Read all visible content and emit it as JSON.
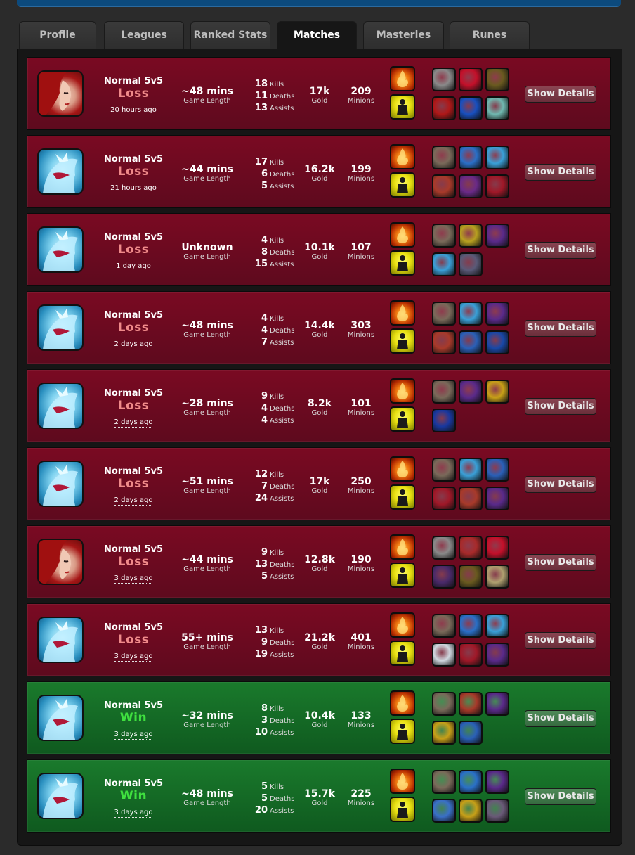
{
  "tabs": [
    "Profile",
    "Leagues",
    "Ranked Stats",
    "Matches",
    "Masteries",
    "Runes"
  ],
  "active_tab": "Matches",
  "labels": {
    "game_length": "Game Length",
    "kills": "Kills",
    "deaths": "Deaths",
    "assists": "Assists",
    "gold": "Gold",
    "minions": "Minions",
    "details_button": "Show Details"
  },
  "spells": [
    "ignite-icon",
    "ghost-icon"
  ],
  "matches": [
    {
      "champion": "red-haired-champion",
      "queue": "Normal 5v5",
      "result": "Loss",
      "ago": "20 hours ago",
      "length": "~48 mins",
      "kills": "18",
      "deaths": "11",
      "assists": "13",
      "gold": "17k",
      "minions": "209",
      "items": [
        "#8a8a8a",
        "#c4102a",
        "#6a5a20",
        "#b01818",
        "#1850c0",
        "#70b8b0"
      ]
    },
    {
      "champion": "ice-champion",
      "queue": "Normal 5v5",
      "result": "Loss",
      "ago": "21 hours ago",
      "length": "~44 mins",
      "kills": "17",
      "deaths": "6",
      "assists": "5",
      "gold": "16.2k",
      "minions": "199",
      "items": [
        "#7a6a5a",
        "#2a70c8",
        "#3aa0d8",
        "#a83a2a",
        "#6a2a88",
        "#a01828"
      ]
    },
    {
      "champion": "ice-champion",
      "queue": "Normal 5v5",
      "result": "Loss",
      "ago": "1 day ago",
      "length": "Unknown",
      "kills": "4",
      "deaths": "8",
      "assists": "15",
      "gold": "10.1k",
      "minions": "107",
      "items": [
        "#7a6a5a",
        "#b8a020",
        "#5a2a8a",
        "#3aa0d8",
        "#5a5a78"
      ]
    },
    {
      "champion": "ice-champion",
      "queue": "Normal 5v5",
      "result": "Loss",
      "ago": "2 days ago",
      "length": "~48 mins",
      "kills": "4",
      "deaths": "4",
      "assists": "7",
      "gold": "14.4k",
      "minions": "303",
      "items": [
        "#7a6a5a",
        "#3aa0d8",
        "#5a2a8a",
        "#a83a2a",
        "#2a60b8",
        "#1848a8"
      ]
    },
    {
      "champion": "ice-champion",
      "queue": "Normal 5v5",
      "result": "Loss",
      "ago": "2 days ago",
      "length": "~28 mins",
      "kills": "9",
      "deaths": "4",
      "assists": "4",
      "gold": "8.2k",
      "minions": "101",
      "items": [
        "#7a6a5a",
        "#5a2a8a",
        "#c8a018",
        "#1838a0"
      ]
    },
    {
      "champion": "ice-champion",
      "queue": "Normal 5v5",
      "result": "Loss",
      "ago": "2 days ago",
      "length": "~51 mins",
      "kills": "12",
      "deaths": "7",
      "assists": "24",
      "gold": "17k",
      "minions": "250",
      "items": [
        "#7a6a5a",
        "#3aa0d8",
        "#2a60b8",
        "#a01828",
        "#a83a2a",
        "#5a2a8a"
      ]
    },
    {
      "champion": "red-haired-champion",
      "queue": "Normal 5v5",
      "result": "Loss",
      "ago": "3 days ago",
      "length": "~44 mins",
      "kills": "9",
      "deaths": "13",
      "assists": "5",
      "gold": "12.8k",
      "minions": "190",
      "items": [
        "#8a8a8a",
        "#a82a2a",
        "#c4102a",
        "#4a2a6a",
        "#6a5a20",
        "#b0a070"
      ]
    },
    {
      "champion": "ice-champion",
      "queue": "Normal 5v5",
      "result": "Loss",
      "ago": "3 days ago",
      "length": "55+ mins",
      "kills": "13",
      "deaths": "9",
      "assists": "19",
      "gold": "21.2k",
      "minions": "401",
      "items": [
        "#7a6a5a",
        "#2a70c8",
        "#3aa0d8",
        "#d0d8e0",
        "#a01828",
        "#5a2a8a"
      ]
    },
    {
      "champion": "ice-champion",
      "queue": "Normal 5v5",
      "result": "Win",
      "ago": "3 days ago",
      "length": "~32 mins",
      "kills": "8",
      "deaths": "3",
      "assists": "10",
      "gold": "10.4k",
      "minions": "133",
      "items": [
        "#7a6a5a",
        "#a83a2a",
        "#5a2a8a",
        "#c8a018",
        "#2a60b8"
      ]
    },
    {
      "champion": "ice-champion",
      "queue": "Normal 5v5",
      "result": "Win",
      "ago": "3 days ago",
      "length": "~48 mins",
      "kills": "5",
      "deaths": "5",
      "assists": "20",
      "gold": "15.7k",
      "minions": "225",
      "items": [
        "#7a6a5a",
        "#2a70c8",
        "#5a2a8a",
        "#3a70c8",
        "#c8a018",
        "#6a5a78"
      ]
    }
  ]
}
